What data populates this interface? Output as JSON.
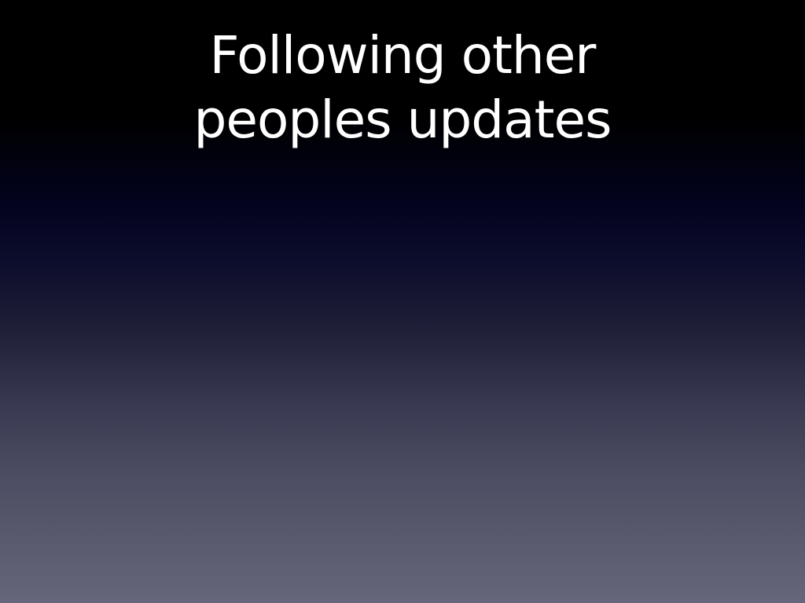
{
  "slide": {
    "title_lines": [
      "Following other",
      "peoples updates"
    ]
  }
}
